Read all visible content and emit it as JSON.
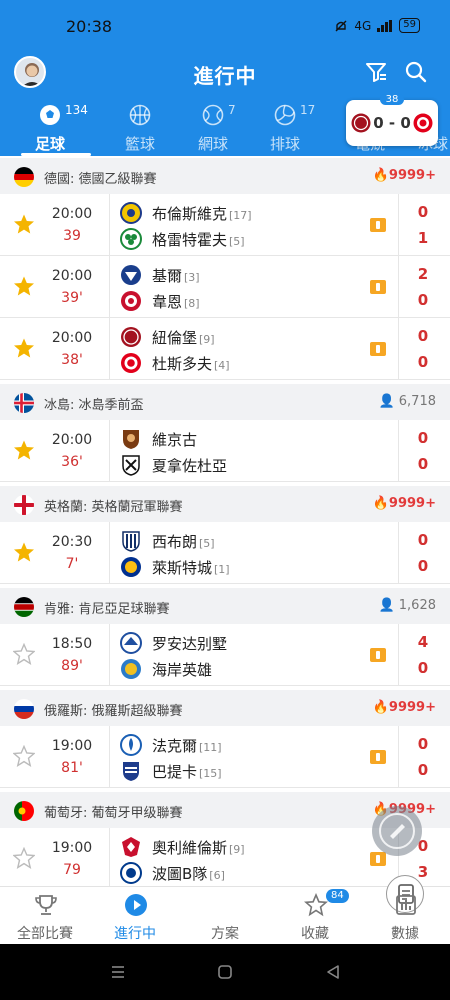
{
  "status_bar": {
    "time": "20:38",
    "net": "4G",
    "battery": "59"
  },
  "header": {
    "title": "進行中"
  },
  "tabs": [
    {
      "label": "足球",
      "count": "134",
      "icon": "football-icon",
      "active": true
    },
    {
      "label": "籃球",
      "count": "",
      "icon": "basketball-icon",
      "active": false
    },
    {
      "label": "網球",
      "count": "7",
      "icon": "tennis-icon",
      "active": false
    },
    {
      "label": "排球",
      "count": "17",
      "icon": "volleyball-icon",
      "active": false
    },
    {
      "label": "電競",
      "count": "",
      "icon": "esports-icon",
      "active": false
    },
    {
      "label": "冰球",
      "count": "",
      "icon": "hockey-icon",
      "active": false
    }
  ],
  "live_popup": {
    "count": "38",
    "score": "0 - 0"
  },
  "leagues": [
    {
      "name": "德國: 德國乙級聯賽",
      "hot": "9999+",
      "views": "",
      "matches": [
        {
          "time": "20:00",
          "minute": "39",
          "starred": true,
          "home": "布倫斯維克",
          "home_rank": "[17]",
          "away": "格雷特霍夫",
          "away_rank": "[5]",
          "home_score": "0",
          "away_score": "1"
        },
        {
          "time": "20:00",
          "minute": "39'",
          "starred": true,
          "home": "基爾",
          "home_rank": "[3]",
          "away": "韋恩",
          "away_rank": "[8]",
          "home_score": "2",
          "away_score": "0"
        },
        {
          "time": "20:00",
          "minute": "38'",
          "starred": true,
          "home": "紐倫堡",
          "home_rank": "[9]",
          "away": "杜斯多夫",
          "away_rank": "[4]",
          "home_score": "0",
          "away_score": "0"
        }
      ]
    },
    {
      "name": "冰島: 冰島季前盃",
      "hot": "",
      "views": "6,718",
      "matches": [
        {
          "time": "20:00",
          "minute": "36'",
          "starred": true,
          "home": "維京古",
          "home_rank": "",
          "away": "夏拿佐杜亞",
          "away_rank": "",
          "home_score": "0",
          "away_score": "0"
        }
      ]
    },
    {
      "name": "英格蘭: 英格蘭冠軍聯賽",
      "hot": "9999+",
      "views": "",
      "matches": [
        {
          "time": "20:30",
          "minute": "7'",
          "starred": true,
          "home": "西布朗",
          "home_rank": "[5]",
          "away": "萊斯特城",
          "away_rank": "[1]",
          "home_score": "0",
          "away_score": "0"
        }
      ]
    },
    {
      "name": "肯雅: 肯尼亞足球聯賽",
      "hot": "",
      "views": "1,628",
      "matches": [
        {
          "time": "18:50",
          "minute": "89'",
          "starred": false,
          "home": "罗安达别墅",
          "home_rank": "",
          "away": "海岸英雄",
          "away_rank": "",
          "home_score": "4",
          "away_score": "0"
        }
      ]
    },
    {
      "name": "俄羅斯: 俄羅斯超級聯賽",
      "hot": "9999+",
      "views": "",
      "matches": [
        {
          "time": "19:00",
          "minute": "81'",
          "starred": false,
          "home": "法克爾",
          "home_rank": "[11]",
          "away": "巴提卡",
          "away_rank": "[15]",
          "home_score": "0",
          "away_score": "0"
        }
      ]
    },
    {
      "name": "葡萄牙: 葡萄牙甲级聯賽",
      "hot": "9999+",
      "views": "",
      "matches": [
        {
          "time": "19:00",
          "minute": "79",
          "starred": false,
          "home": "奧利維倫斯",
          "home_rank": "[9]",
          "away": "波圖B隊",
          "away_rank": "[6]",
          "home_score": "0",
          "away_score": "3"
        }
      ]
    }
  ],
  "bottom_nav": [
    {
      "label": "全部比賽",
      "icon": "trophy-icon",
      "active": false,
      "badge": ""
    },
    {
      "label": "進行中",
      "icon": "play-icon",
      "active": true,
      "badge": ""
    },
    {
      "label": "方案",
      "icon": "document-icon",
      "active": false,
      "badge": ""
    },
    {
      "label": "收藏",
      "icon": "star-icon",
      "active": false,
      "badge": "84"
    },
    {
      "label": "數據",
      "icon": "chart-icon",
      "active": false,
      "badge": ""
    }
  ],
  "colors": {
    "primary": "#1f8ae6",
    "score": "#d23030",
    "star": "#f4b400",
    "hot": "#e23b3b"
  }
}
